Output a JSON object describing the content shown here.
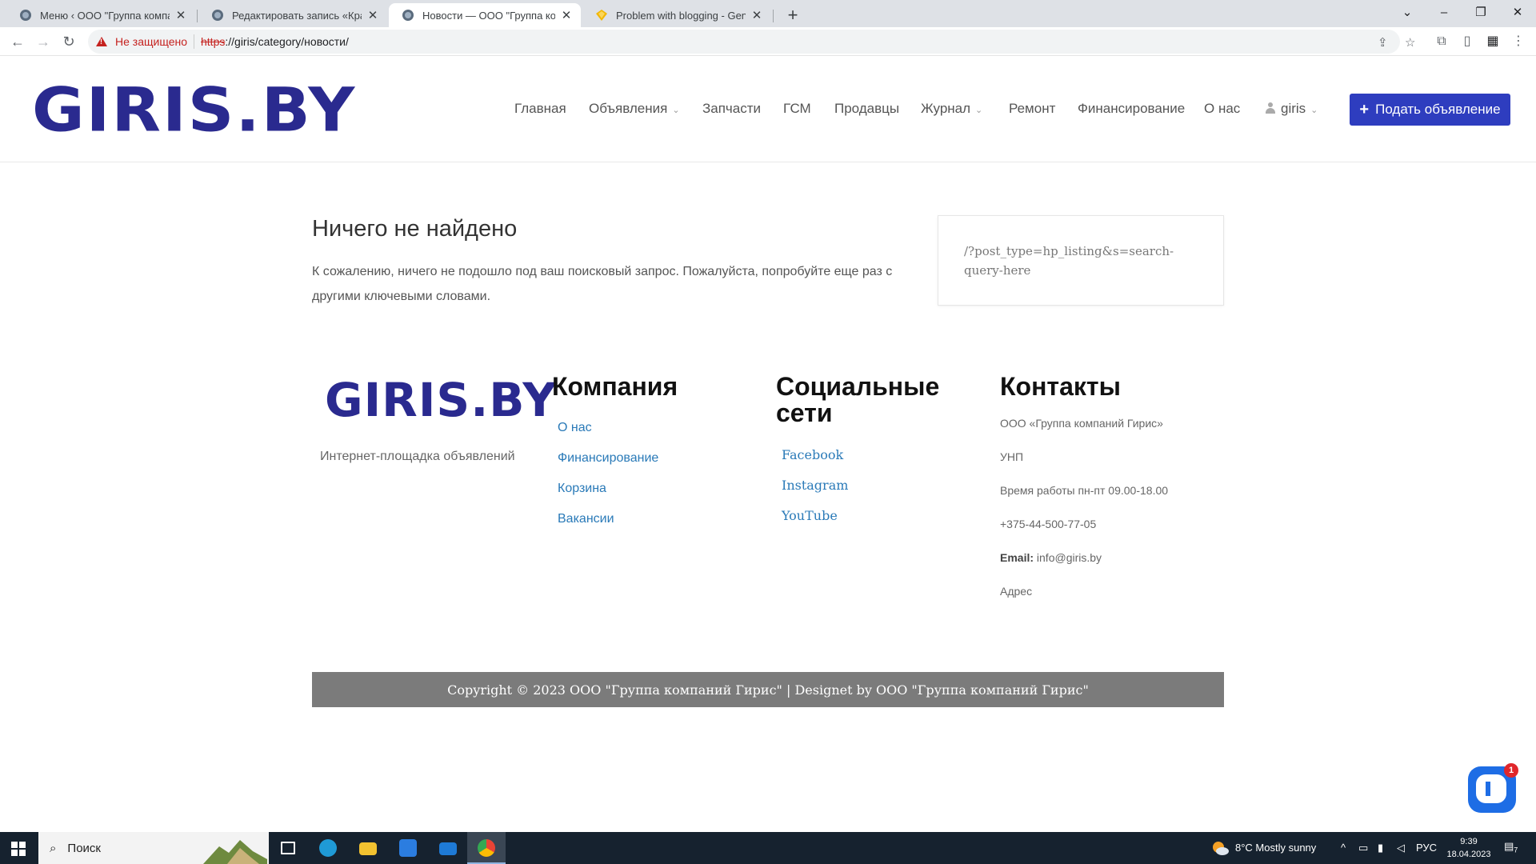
{
  "browser": {
    "tabs": [
      {
        "label": "Меню ‹ ООО \"Группа компаний",
        "close": "✕"
      },
      {
        "label": "Редактировать запись «Краткая",
        "close": "✕"
      },
      {
        "label": "Новости — ООО \"Группа компа",
        "close": "✕"
      },
      {
        "label": "Problem with blogging - Genera",
        "close": "✕"
      }
    ],
    "new_tab": "+",
    "security_warning": "Не защищено",
    "url_scheme": "https",
    "url_rest": "://giris/category/новости/"
  },
  "site": {
    "logo": "GIRIS.BY",
    "nav": {
      "home": "Главная",
      "listings": "Объявления",
      "parts": "Запчасти",
      "fuel": "ГСМ",
      "sellers": "Продавцы",
      "journal": "Журнал",
      "repair": "Ремонт",
      "finance": "Финансирование",
      "about": "О нас",
      "user": "giris"
    },
    "post_button": "Подать объявление"
  },
  "main": {
    "title": "Ничего не найдено",
    "text": "К сожалению, ничего не подошло под ваш поисковый запрос. Пожалуйста, попробуйте еще раз с другими ключевыми словами.",
    "search_query": "/?post_type=hp_listing&s=search-query-here"
  },
  "footer": {
    "logo": "GIRIS.BY",
    "tagline": "Интернет-площадка объявлений",
    "company": {
      "heading": "Компания",
      "links": [
        "О нас",
        "Финансирование",
        "Корзина",
        "Вакансии"
      ]
    },
    "social": {
      "heading": "Социальные сети",
      "links": [
        "Facebook",
        "Instagram",
        "YouTube"
      ]
    },
    "contacts": {
      "heading": "Контакты",
      "company_name": "ООО «Группа компаний Гирис»",
      "unp": "УНП",
      "hours": "Время работы пн-пт 09.00-18.00",
      "phone": "+375-44-500-77-05",
      "email_label": "Email:",
      "email": "info@giris.by",
      "address": "Адрес"
    },
    "copyright": "Copyright © 2023 ООО \"Группа компаний Гирис\" | Designet by ООО \"Группа компаний Гирис\""
  },
  "chat": {
    "badge": "1"
  },
  "taskbar": {
    "search_placeholder": "Поиск",
    "weather": "8°C  Mostly sunny",
    "language": "РУС",
    "time": "9:39",
    "date": "18.04.2023",
    "notifications": "7"
  },
  "colors": {
    "brand": "#2a2a8f",
    "button": "#2e3dbf",
    "link": "#2a7ab8",
    "copyright_bg": "#7b7b7b"
  }
}
